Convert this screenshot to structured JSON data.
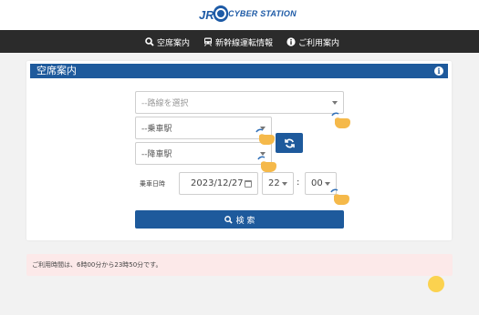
{
  "header": {
    "logo_jr": "JR",
    "logo_brand": "CYBER STATION"
  },
  "nav": {
    "items": [
      {
        "label": "空席案内",
        "icon": "search-icon"
      },
      {
        "label": "新幹線運転情報",
        "icon": "train-icon"
      },
      {
        "label": "ご利用案内",
        "icon": "info-icon"
      }
    ]
  },
  "panel": {
    "title": "空席案内",
    "route_placeholder": "--路線を選択",
    "departure_placeholder": "--乗車駅",
    "arrival_placeholder": "--降車駅",
    "date_label": "乗車日時",
    "date_value": "2023/12/27",
    "hour_value": "22",
    "time_separator": ":",
    "minute_value": "00",
    "search_label": "検 索"
  },
  "notice": {
    "text": "ご利用時間は、6時00分から23時50分です。"
  },
  "colors": {
    "primary": "#1e5a9c",
    "navbar": "#2b2b2b",
    "notice_bg": "#fce9e9",
    "hand": "#f5b94a"
  }
}
